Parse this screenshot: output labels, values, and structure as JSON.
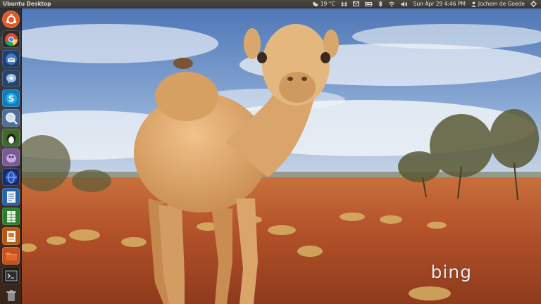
{
  "panel": {
    "title": "Ubuntu Desktop",
    "weather": "19 °C",
    "datetime": "Sun Apr 29  4:46 PM",
    "user": "Jochem de Goede"
  },
  "indicators": [
    "weather-icon",
    "dropbox-icon",
    "mail-icon",
    "battery-icon",
    "bluetooth-icon",
    "wifi-icon",
    "volume-icon",
    "user-icon",
    "gear-icon"
  ],
  "launcher": {
    "items": [
      {
        "name": "dash-home-icon",
        "color": "#e15a23"
      },
      {
        "name": "chrome-icon",
        "color": "#f2f2f2"
      },
      {
        "name": "thunderbird-icon",
        "color": "#2b5fa6"
      },
      {
        "name": "empathy-chat-icon",
        "color": "#5a8fd0"
      },
      {
        "name": "skype-icon",
        "color": "#1ba7e6"
      },
      {
        "name": "magnifier-icon",
        "color": "#7c9fcf"
      },
      {
        "name": "penguin-icon",
        "color": "#e6c21f"
      },
      {
        "name": "pidgin-icon",
        "color": "#b68ad6"
      },
      {
        "name": "globe-icon",
        "color": "#2a4aa0"
      },
      {
        "name": "writer-icon",
        "color": "#2f6ec4"
      },
      {
        "name": "calc-icon",
        "color": "#3a9a3a"
      },
      {
        "name": "impress-icon",
        "color": "#e07820"
      },
      {
        "name": "files-icon",
        "color": "#e4662d"
      },
      {
        "name": "terminal-icon",
        "color": "#2f2f2f"
      },
      {
        "name": "trash-icon",
        "color": "#9a9a9a"
      }
    ]
  },
  "wallpaper": {
    "brand": "bing",
    "colors": {
      "sky": "#6f93c8",
      "clouds": "#eef2f7",
      "ground": "#b8552a",
      "camel": "#d9a56a"
    }
  }
}
